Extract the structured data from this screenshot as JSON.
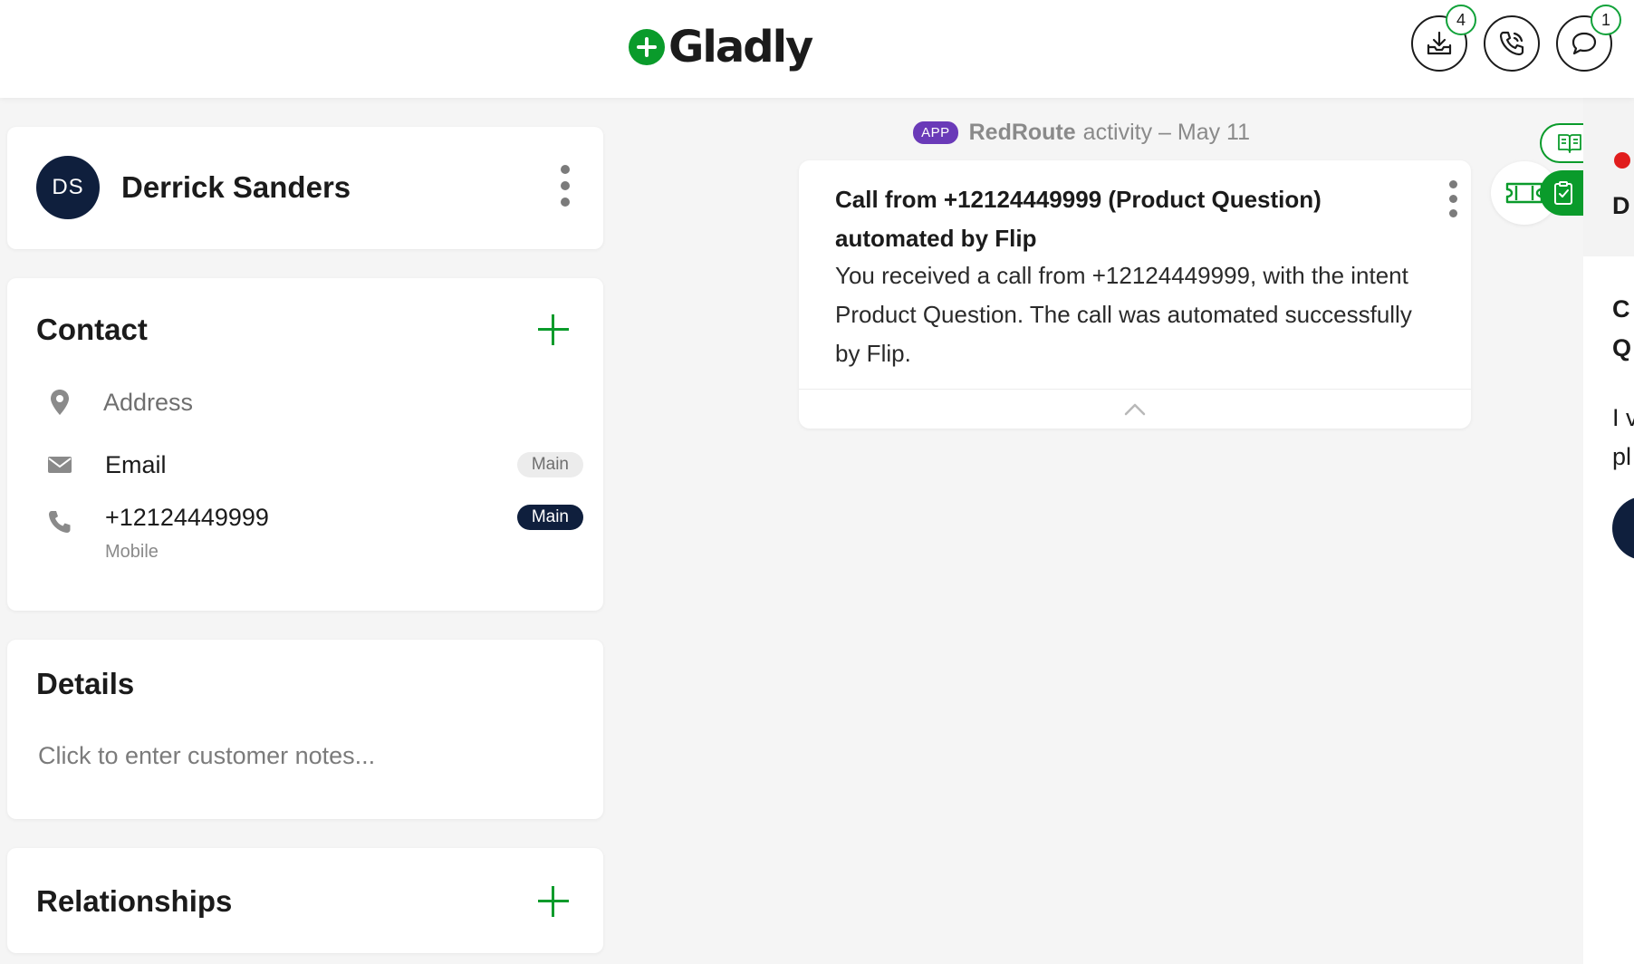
{
  "header": {
    "logo_text": "Gladly",
    "brand_color": "#0a9b2b",
    "inbox_badge": "4",
    "chat_badge": "1",
    "icons": [
      "inbox-download-icon",
      "phone-icon",
      "chat-bubble-icon"
    ]
  },
  "profile": {
    "initials": "DS",
    "name": "Derrick Sanders"
  },
  "contact": {
    "title": "Contact",
    "address_placeholder": "Address",
    "email_label": "Email",
    "email_tag": "Main",
    "phone_number": "+12124449999",
    "phone_type": "Mobile",
    "phone_tag": "Main"
  },
  "details": {
    "title": "Details",
    "notes_placeholder": "Click to enter customer notes..."
  },
  "relationships": {
    "title": "Relationships"
  },
  "feed": {
    "app_badge": "APP",
    "app_name": "RedRoute",
    "activity_meta": "activity – May 11",
    "activity": {
      "title": "Call from +12124449999 (Product Question) automated by Flip",
      "body": "You received a call from +12124449999, with the intent Product Question. The call was automated successfully by Flip."
    }
  },
  "side_panel": {
    "heading_fragment": "D",
    "title_fragment_1": "C",
    "title_fragment_2": "Q",
    "text_fragment_1": "I v",
    "text_fragment_2": "pl",
    "status_color": "#e11d1d"
  }
}
